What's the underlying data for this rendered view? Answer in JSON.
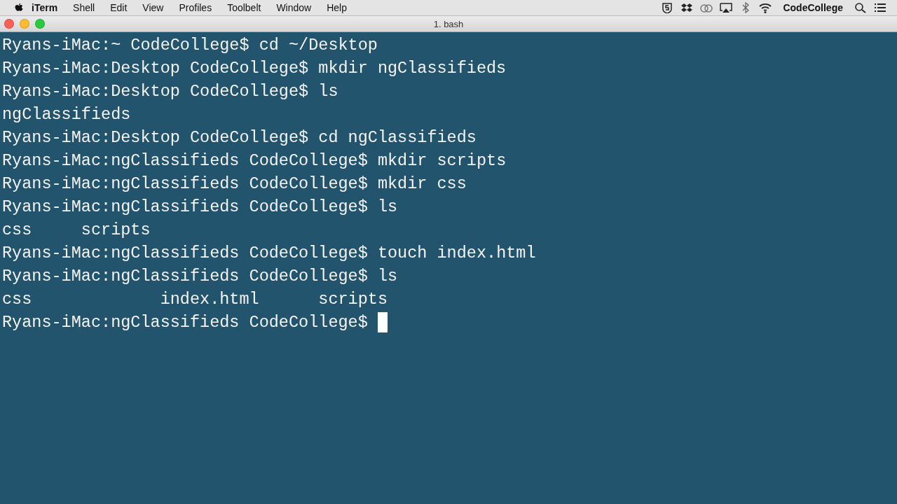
{
  "menu_bar": {
    "app_name": "iTerm",
    "menus": [
      "Shell",
      "Edit",
      "View",
      "Profiles",
      "Toolbelt",
      "Window",
      "Help"
    ],
    "user": "CodeCollege"
  },
  "window": {
    "title": "1. bash"
  },
  "terminal": {
    "lines": [
      {
        "kind": "command",
        "prompt": "Ryans-iMac:~ CodeCollege$",
        "command": "cd ~/Desktop"
      },
      {
        "kind": "command",
        "prompt": "Ryans-iMac:Desktop CodeCollege$",
        "command": "mkdir ngClassifieds"
      },
      {
        "kind": "command",
        "prompt": "Ryans-iMac:Desktop CodeCollege$",
        "command": "ls"
      },
      {
        "kind": "output",
        "text": "ngClassifieds"
      },
      {
        "kind": "command",
        "prompt": "Ryans-iMac:Desktop CodeCollege$",
        "command": "cd ngClassifieds"
      },
      {
        "kind": "command",
        "prompt": "Ryans-iMac:ngClassifieds CodeCollege$",
        "command": "mkdir scripts"
      },
      {
        "kind": "command",
        "prompt": "Ryans-iMac:ngClassifieds CodeCollege$",
        "command": "mkdir css"
      },
      {
        "kind": "command",
        "prompt": "Ryans-iMac:ngClassifieds CodeCollege$",
        "command": "ls"
      },
      {
        "kind": "output",
        "text": "css     scripts"
      },
      {
        "kind": "command",
        "prompt": "Ryans-iMac:ngClassifieds CodeCollege$",
        "command": "touch index.html"
      },
      {
        "kind": "command",
        "prompt": "Ryans-iMac:ngClassifieds CodeCollege$",
        "command": "ls"
      },
      {
        "kind": "output",
        "text": "css             index.html      scripts"
      },
      {
        "kind": "input",
        "prompt": "Ryans-iMac:ngClassifieds CodeCollege$"
      }
    ]
  }
}
